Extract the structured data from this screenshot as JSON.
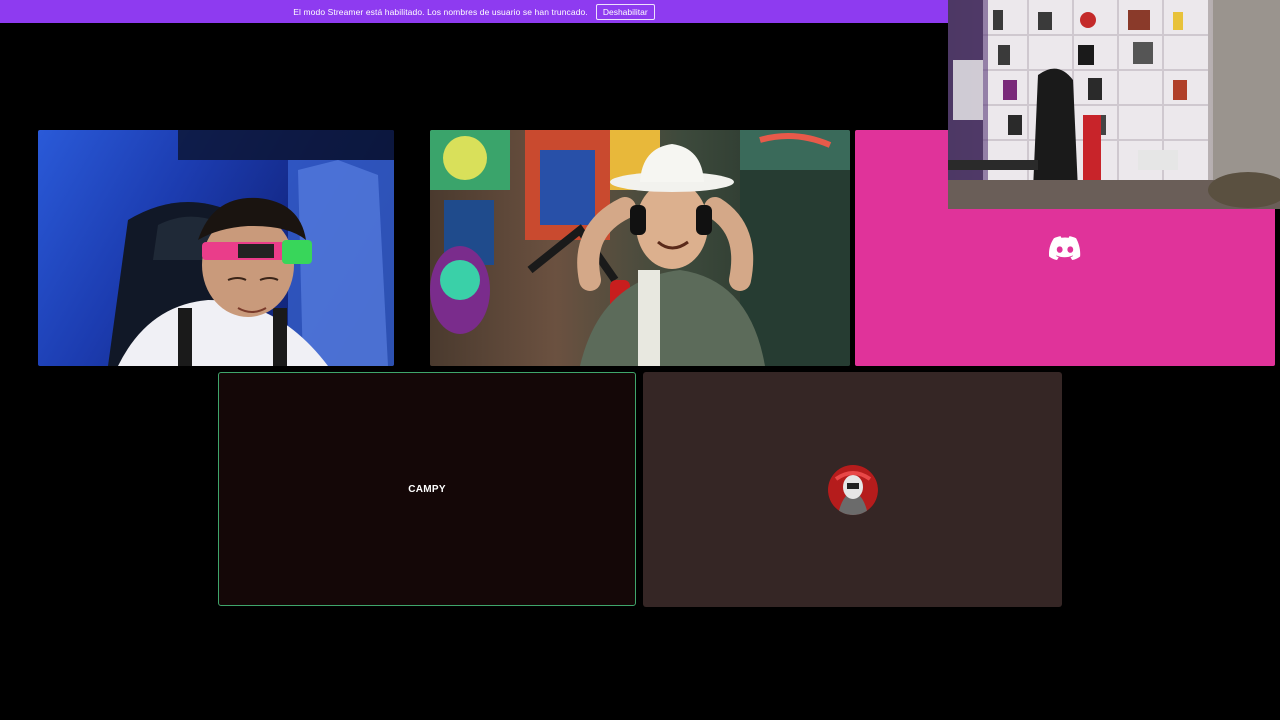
{
  "banner": {
    "message": "El modo Streamer está habilitado. Los nombres de usuario se han truncado.",
    "disable_label": "Deshabilitar"
  },
  "participants": [
    {
      "type": "video"
    },
    {
      "type": "video"
    },
    {
      "type": "discord-avatar",
      "icon": "discord-icon",
      "color": "#e0339a"
    },
    {
      "type": "name",
      "name": "CAMPY",
      "speaking": true,
      "border_color": "#3fa56b"
    },
    {
      "type": "avatar",
      "icon": "user-avatar"
    }
  ],
  "colors": {
    "banner": "#8e3bf0",
    "speaking_border": "#3fa56b",
    "discord_tile": "#e0339a"
  }
}
